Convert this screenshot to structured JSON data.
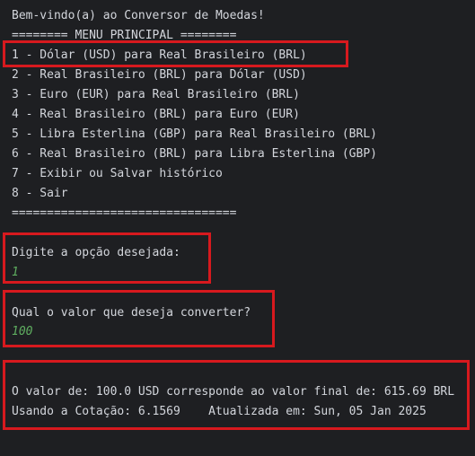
{
  "console": {
    "welcome": "Bem-vindo(a) ao Conversor de Moedas!",
    "menu_header": "======== MENU PRINCIPAL ========",
    "menu_items": [
      "1 - Dólar (USD) para Real Brasileiro (BRL)",
      "2 - Real Brasileiro (BRL) para Dólar (USD)",
      "3 - Euro (EUR) para Real Brasileiro (BRL)",
      "4 - Real Brasileiro (BRL) para Euro (EUR)",
      "5 - Libra Esterlina (GBP) para Real Brasileiro (BRL)",
      "6 - Real Brasileiro (BRL) para Libra Esterlina (GBP)",
      "7 - Exibir ou Salvar histórico",
      "8 - Sair"
    ],
    "menu_footer": "================================",
    "option_prompt": "Digite a opção desejada:",
    "option_input": "1",
    "value_prompt": "Qual o valor que deseja converter?",
    "value_input": "100",
    "result_line": "O valor de: 100.0 USD corresponde ao valor final de: 615.69 BRL",
    "rate_line": "Usando a Cotação: 6.1569    Atualizada em: Sun, 05 Jan 2025"
  },
  "colors": {
    "background": "#1e1f22",
    "text": "#d3d6dc",
    "user_input": "#5fae60",
    "highlight_border": "#d7191e"
  }
}
